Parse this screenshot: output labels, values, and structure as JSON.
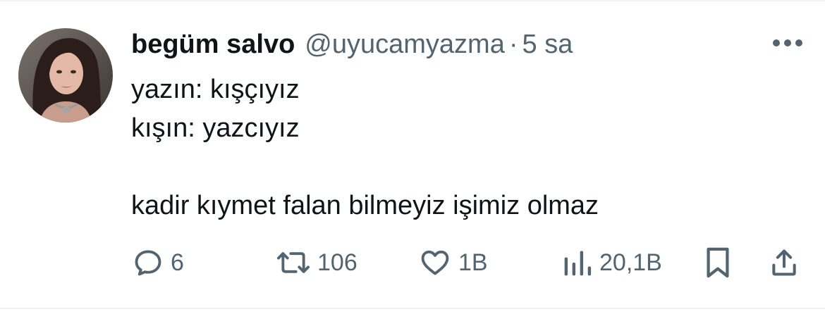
{
  "tweet": {
    "display_name": "begüm salvo",
    "handle": "@uyucamyazma",
    "separator": "·",
    "time": "5 sa",
    "lines": [
      "yazın: kışçıyız",
      "kışın: yazcıyız",
      "kadir kıymet falan bilmeyiz işimiz olmaz"
    ]
  },
  "actions": {
    "replies": "6",
    "retweets": "106",
    "likes": "1B",
    "views": "20,1B"
  },
  "icons": {
    "more": "more-horizontal-icon",
    "reply": "reply-icon",
    "retweet": "retweet-icon",
    "like": "heart-icon",
    "views": "views-bar-chart-icon",
    "bookmark": "bookmark-icon",
    "share": "share-icon"
  },
  "colors": {
    "text_primary": "#0f1419",
    "text_secondary": "#536471",
    "divider": "#eff3f4"
  }
}
